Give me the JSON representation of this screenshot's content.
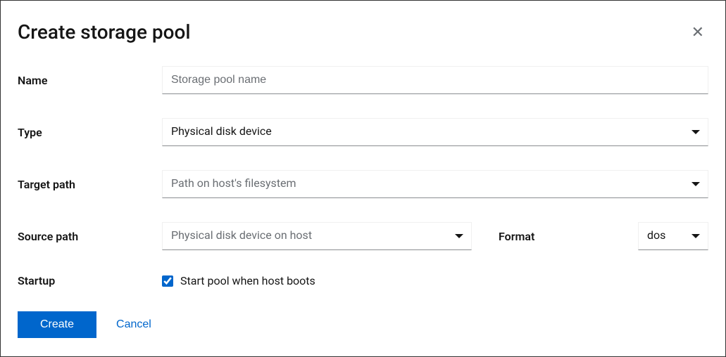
{
  "modal": {
    "title": "Create storage pool"
  },
  "fields": {
    "name": {
      "label": "Name",
      "placeholder": "Storage pool name",
      "value": ""
    },
    "type": {
      "label": "Type",
      "value": "Physical disk device"
    },
    "target_path": {
      "label": "Target path",
      "placeholder": "Path on host's filesystem",
      "value": ""
    },
    "source_path": {
      "label": "Source path",
      "placeholder": "Physical disk device on host",
      "value": ""
    },
    "format": {
      "label": "Format",
      "value": "dos"
    },
    "startup": {
      "label": "Startup",
      "checkbox_label": "Start pool when host boots",
      "checked": true
    }
  },
  "footer": {
    "create": "Create",
    "cancel": "Cancel"
  }
}
